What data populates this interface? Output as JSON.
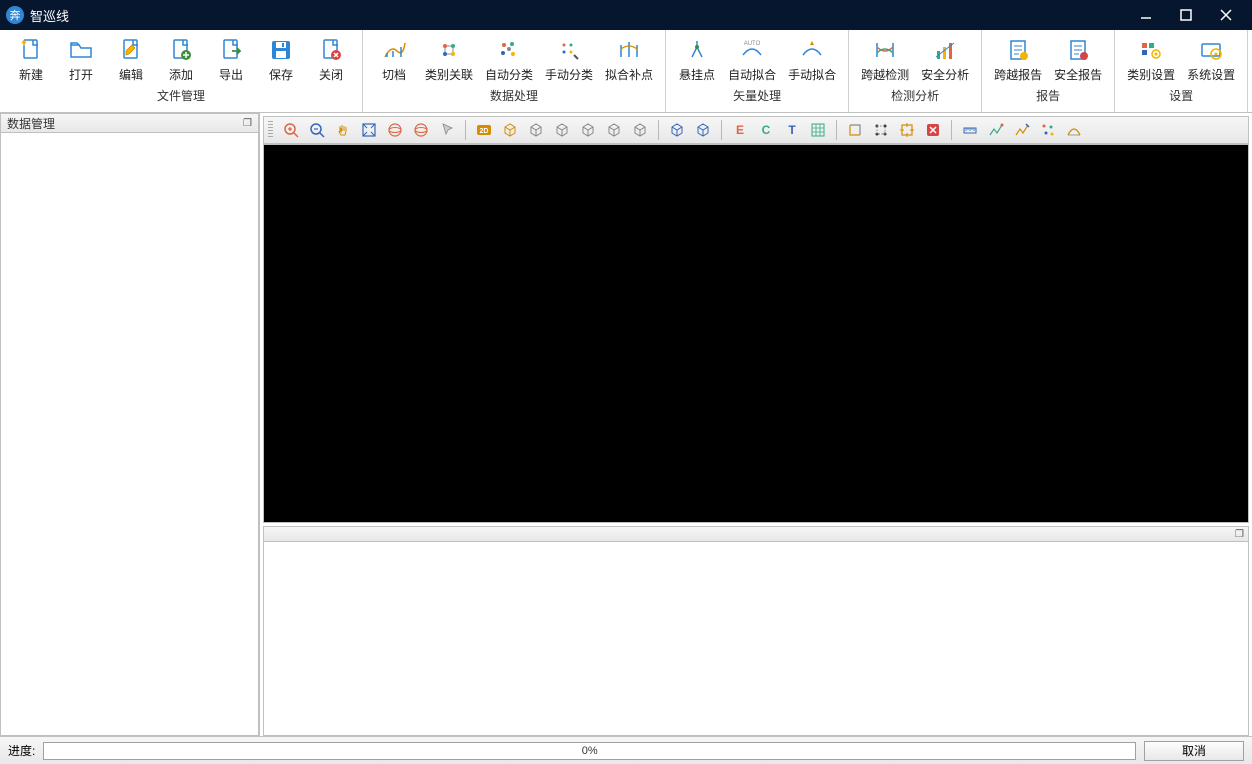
{
  "app": {
    "title": "智巡线"
  },
  "ribbon": {
    "groups": [
      {
        "title": "文件管理",
        "buttons": [
          {
            "name": "new-button",
            "label": "新建",
            "icon": "file-new"
          },
          {
            "name": "open-button",
            "label": "打开",
            "icon": "folder-open"
          },
          {
            "name": "edit-button",
            "label": "编辑",
            "icon": "file-edit"
          },
          {
            "name": "add-button",
            "label": "添加",
            "icon": "file-add"
          },
          {
            "name": "export-button",
            "label": "导出",
            "icon": "file-export"
          },
          {
            "name": "save-button",
            "label": "保存",
            "icon": "save"
          },
          {
            "name": "close-button",
            "label": "关闭",
            "icon": "file-close"
          }
        ]
      },
      {
        "title": "数据处理",
        "buttons": [
          {
            "name": "qiedang-button",
            "label": "切档",
            "icon": "qiedang"
          },
          {
            "name": "category-link-button",
            "label": "类别关联",
            "icon": "cat-link"
          },
          {
            "name": "auto-classify-button",
            "label": "自动分类",
            "icon": "auto-class"
          },
          {
            "name": "manual-classify-button",
            "label": "手动分类",
            "icon": "manual-class"
          },
          {
            "name": "fit-supplement-button",
            "label": "拟合补点",
            "icon": "fit-supp"
          }
        ]
      },
      {
        "title": "矢量处理",
        "buttons": [
          {
            "name": "hang-point-button",
            "label": "悬挂点",
            "icon": "hang-pt"
          },
          {
            "name": "auto-fit-button",
            "label": "自动拟合",
            "icon": "auto-fit"
          },
          {
            "name": "manual-fit-button",
            "label": "手动拟合",
            "icon": "manual-fit"
          }
        ]
      },
      {
        "title": "检测分析",
        "buttons": [
          {
            "name": "cross-detect-button",
            "label": "跨越检测",
            "icon": "cross-detect"
          },
          {
            "name": "safety-analysis-button",
            "label": "安全分析",
            "icon": "safety"
          }
        ]
      },
      {
        "title": "报告",
        "buttons": [
          {
            "name": "cross-report-button",
            "label": "跨越报告",
            "icon": "report1"
          },
          {
            "name": "safety-report-button",
            "label": "安全报告",
            "icon": "report2"
          }
        ]
      },
      {
        "title": "设置",
        "buttons": [
          {
            "name": "category-settings-button",
            "label": "类别设置",
            "icon": "cat-set"
          },
          {
            "name": "system-settings-button",
            "label": "系统设置",
            "icon": "sys-set"
          }
        ]
      }
    ]
  },
  "sidepanel": {
    "title": "数据管理"
  },
  "toolbar2": {
    "items": [
      {
        "name": "zoom-in-icon",
        "i": "zin"
      },
      {
        "name": "zoom-out-icon",
        "i": "zout"
      },
      {
        "name": "pan-icon",
        "i": "pan"
      },
      {
        "name": "view-fit-icon",
        "i": "fit"
      },
      {
        "name": "orbit-icon",
        "i": "orb"
      },
      {
        "name": "orbit2-icon",
        "i": "orb"
      },
      {
        "name": "cursor-icon",
        "i": "cur"
      },
      {
        "sep": true
      },
      {
        "name": "view-2d-icon",
        "i": "2d"
      },
      {
        "name": "view-3d-icon",
        "i": "3d"
      },
      {
        "name": "view-front-icon",
        "i": "cube"
      },
      {
        "name": "view-back-icon",
        "i": "cube"
      },
      {
        "name": "view-left-icon",
        "i": "cube"
      },
      {
        "name": "view-right-icon",
        "i": "cube"
      },
      {
        "name": "view-top-icon",
        "i": "cube"
      },
      {
        "sep": true
      },
      {
        "name": "box1-icon",
        "i": "boxb"
      },
      {
        "name": "box2-icon",
        "i": "boxb"
      },
      {
        "sep": true
      },
      {
        "name": "letter-e-icon",
        "i": "E",
        "c": "#d64"
      },
      {
        "name": "letter-c-icon",
        "i": "C",
        "c": "#3a8"
      },
      {
        "name": "letter-t-icon",
        "i": "T",
        "c": "#36b"
      },
      {
        "name": "grid-icon",
        "i": "grid"
      },
      {
        "sep": true
      },
      {
        "name": "tool-a-icon",
        "i": "ta"
      },
      {
        "name": "tool-b-icon",
        "i": "tb"
      },
      {
        "name": "tool-c-icon",
        "i": "tc"
      },
      {
        "name": "tool-x-icon",
        "i": "x"
      },
      {
        "sep": true
      },
      {
        "name": "ruler-icon",
        "i": "rul"
      },
      {
        "name": "sample1-icon",
        "i": "s1"
      },
      {
        "name": "sample2-icon",
        "i": "s2"
      },
      {
        "name": "points-icon",
        "i": "pts"
      },
      {
        "name": "arc-icon",
        "i": "arc"
      }
    ]
  },
  "status": {
    "progress_label": "进度:",
    "progress_pct": "0%",
    "cancel": "取消"
  }
}
